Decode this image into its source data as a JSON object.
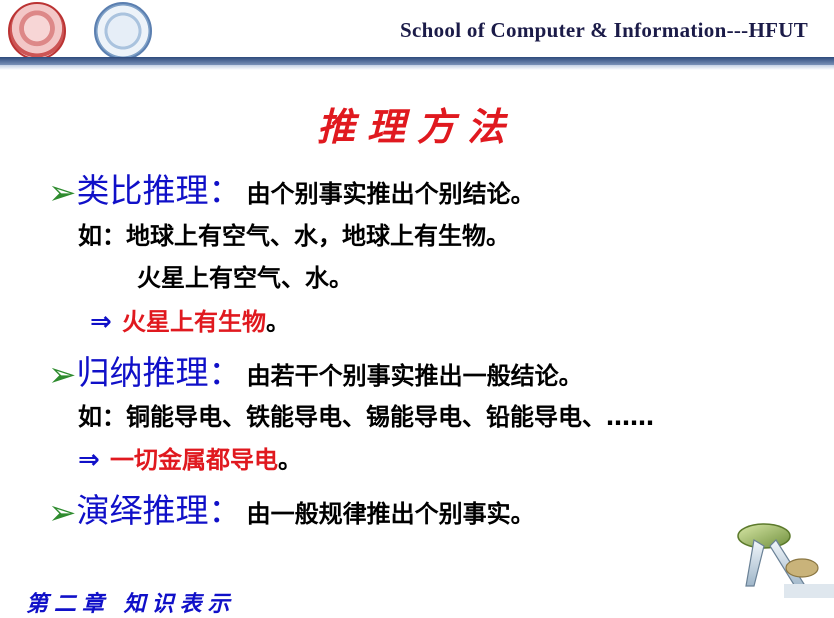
{
  "header": {
    "school": "School of Computer & Information---HFUT"
  },
  "title": "推理方法",
  "items": [
    {
      "term": "类比推理：",
      "desc": "由个别事实推出个别结论。",
      "example_line1": "如：地球上有空气、水，地球上有生物。",
      "example_line2": "火星上有空气、水。",
      "arrow": "⇒",
      "conclusion": "火星上有生物",
      "conclusion_end": "。"
    },
    {
      "term": "归纳推理：",
      "desc": "由若干个别事实推出一般结论。",
      "example_line1": "如：铜能导电、铁能导电、锡能导电、铅能导电、……",
      "arrow": "⇒",
      "conclusion": "一切金属都导电",
      "conclusion_end": "。"
    },
    {
      "term": "演绎推理：",
      "desc": "由一般规律推出个别事实。"
    }
  ],
  "footer": "第二章 知识表示",
  "colors": {
    "title_red": "#e0191f",
    "term_blue": "#1010c8",
    "bullet_green": "#2e8b2e",
    "header_rule": "#2d4a7c"
  },
  "icons": {
    "bullet": "arrow-bullet-icon",
    "implies": "double-arrow-icon"
  }
}
